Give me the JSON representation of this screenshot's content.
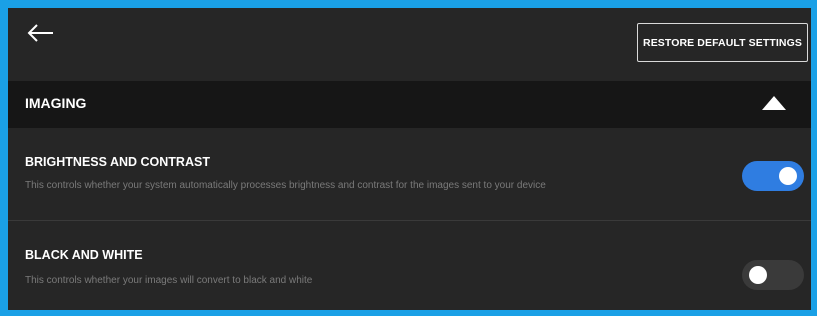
{
  "header": {
    "back_icon": "arrow-left-icon",
    "restore_label": "RESTORE DEFAULT SETTINGS"
  },
  "section": {
    "title": "IMAGING",
    "expanded": true,
    "collapse_icon": "triangle-up-icon"
  },
  "settings": [
    {
      "title": "BRIGHTNESS AND CONTRAST",
      "description": "This controls whether your system automatically processes brightness and contrast for the images sent to your device",
      "enabled": true
    },
    {
      "title": "BLACK AND WHITE",
      "description": "This controls whether your images will convert to black and white",
      "enabled": false
    }
  ],
  "colors": {
    "accent": "#2f7de1",
    "frame_border": "#1aa0e6",
    "background": "#262626",
    "section_header": "#161616",
    "toggle_off": "#3a3a3a"
  }
}
